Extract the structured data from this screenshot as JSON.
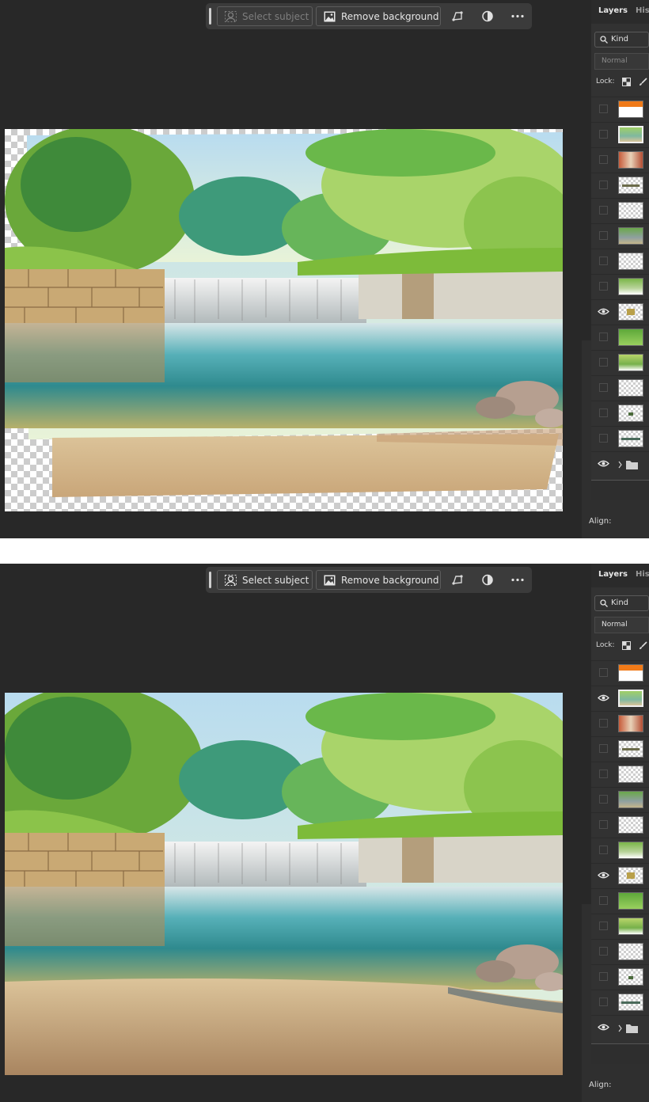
{
  "panes": [
    {
      "id": "before",
      "taskbar": {
        "select_subject": "Select subject",
        "select_subject_enabled": false,
        "remove_background": "Remove background"
      },
      "layers_panel": {
        "tabs": [
          "Layers",
          "Hist"
        ],
        "filter": "Kind",
        "blend_mode": "Normal",
        "lock_label": "Lock:",
        "align_label": "Align:",
        "rows": [
          {
            "thumb": "orange",
            "visible": false,
            "selected": false
          },
          {
            "thumb": "scene",
            "visible": false,
            "selected": true
          },
          {
            "thumb": "photo",
            "visible": false,
            "selected": false
          },
          {
            "thumb": "strip",
            "visible": false,
            "selected": false
          },
          {
            "thumb": "empty",
            "visible": false,
            "selected": false
          },
          {
            "thumb": "scene",
            "visible": false,
            "selected": false
          },
          {
            "thumb": "empty",
            "visible": false,
            "selected": false
          },
          {
            "thumb": "scene",
            "visible": false,
            "selected": false
          },
          {
            "thumb": "small",
            "visible": true,
            "selected": false
          },
          {
            "thumb": "green",
            "visible": false,
            "selected": false
          },
          {
            "thumb": "scene",
            "visible": false,
            "selected": false
          },
          {
            "thumb": "empty",
            "visible": false,
            "selected": false
          },
          {
            "thumb": "dot",
            "visible": false,
            "selected": false
          },
          {
            "thumb": "strip",
            "visible": false,
            "selected": false
          },
          {
            "thumb": "folder",
            "visible": true,
            "selected": false
          }
        ]
      }
    },
    {
      "id": "after",
      "taskbar": {
        "select_subject": "Select subject",
        "select_subject_enabled": true,
        "remove_background": "Remove background"
      },
      "layers_panel": {
        "tabs": [
          "Layers",
          "Hist"
        ],
        "filter": "Kind",
        "blend_mode": "Normal",
        "lock_label": "Lock:",
        "align_label": "Align:",
        "rows": [
          {
            "thumb": "orange",
            "visible": false,
            "selected": false
          },
          {
            "thumb": "scene",
            "visible": true,
            "selected": true
          },
          {
            "thumb": "photo",
            "visible": false,
            "selected": false
          },
          {
            "thumb": "strip",
            "visible": false,
            "selected": false
          },
          {
            "thumb": "empty",
            "visible": false,
            "selected": false
          },
          {
            "thumb": "scene",
            "visible": false,
            "selected": false
          },
          {
            "thumb": "empty",
            "visible": false,
            "selected": false
          },
          {
            "thumb": "scene",
            "visible": false,
            "selected": false
          },
          {
            "thumb": "small",
            "visible": true,
            "selected": false
          },
          {
            "thumb": "green",
            "visible": false,
            "selected": false
          },
          {
            "thumb": "scene",
            "visible": false,
            "selected": false
          },
          {
            "thumb": "empty",
            "visible": false,
            "selected": false
          },
          {
            "thumb": "dot",
            "visible": false,
            "selected": false
          },
          {
            "thumb": "strip",
            "visible": false,
            "selected": false
          },
          {
            "thumb": "folder",
            "visible": true,
            "selected": false
          }
        ]
      }
    }
  ],
  "icons": {
    "select_subject": "person-icon",
    "remove_background": "image-icon",
    "symbol": "crop-shape-icon",
    "adjust": "contrast-icon",
    "more": "more-icon",
    "search": "search-icon",
    "lock_transparent": "checker-icon",
    "lock_brush": "brush-icon",
    "visibility": "eye-icon",
    "group": "folder-icon"
  },
  "colors": {
    "app_bg": "#282828",
    "taskbar_bg": "#3b3b3b",
    "panel_bg": "#323232",
    "accent_orange": "#f07a18"
  }
}
